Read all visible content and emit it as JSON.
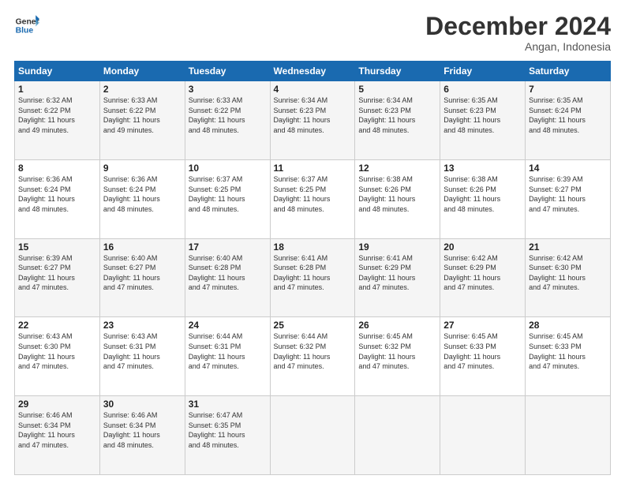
{
  "logo": {
    "line1": "General",
    "line2": "Blue"
  },
  "header": {
    "month": "December 2024",
    "location": "Angan, Indonesia"
  },
  "weekdays": [
    "Sunday",
    "Monday",
    "Tuesday",
    "Wednesday",
    "Thursday",
    "Friday",
    "Saturday"
  ],
  "weeks": [
    [
      {
        "day": "1",
        "info": "Sunrise: 6:32 AM\nSunset: 6:22 PM\nDaylight: 11 hours\nand 49 minutes."
      },
      {
        "day": "2",
        "info": "Sunrise: 6:33 AM\nSunset: 6:22 PM\nDaylight: 11 hours\nand 49 minutes."
      },
      {
        "day": "3",
        "info": "Sunrise: 6:33 AM\nSunset: 6:22 PM\nDaylight: 11 hours\nand 48 minutes."
      },
      {
        "day": "4",
        "info": "Sunrise: 6:34 AM\nSunset: 6:23 PM\nDaylight: 11 hours\nand 48 minutes."
      },
      {
        "day": "5",
        "info": "Sunrise: 6:34 AM\nSunset: 6:23 PM\nDaylight: 11 hours\nand 48 minutes."
      },
      {
        "day": "6",
        "info": "Sunrise: 6:35 AM\nSunset: 6:23 PM\nDaylight: 11 hours\nand 48 minutes."
      },
      {
        "day": "7",
        "info": "Sunrise: 6:35 AM\nSunset: 6:24 PM\nDaylight: 11 hours\nand 48 minutes."
      }
    ],
    [
      {
        "day": "8",
        "info": "Sunrise: 6:36 AM\nSunset: 6:24 PM\nDaylight: 11 hours\nand 48 minutes."
      },
      {
        "day": "9",
        "info": "Sunrise: 6:36 AM\nSunset: 6:24 PM\nDaylight: 11 hours\nand 48 minutes."
      },
      {
        "day": "10",
        "info": "Sunrise: 6:37 AM\nSunset: 6:25 PM\nDaylight: 11 hours\nand 48 minutes."
      },
      {
        "day": "11",
        "info": "Sunrise: 6:37 AM\nSunset: 6:25 PM\nDaylight: 11 hours\nand 48 minutes."
      },
      {
        "day": "12",
        "info": "Sunrise: 6:38 AM\nSunset: 6:26 PM\nDaylight: 11 hours\nand 48 minutes."
      },
      {
        "day": "13",
        "info": "Sunrise: 6:38 AM\nSunset: 6:26 PM\nDaylight: 11 hours\nand 48 minutes."
      },
      {
        "day": "14",
        "info": "Sunrise: 6:39 AM\nSunset: 6:27 PM\nDaylight: 11 hours\nand 47 minutes."
      }
    ],
    [
      {
        "day": "15",
        "info": "Sunrise: 6:39 AM\nSunset: 6:27 PM\nDaylight: 11 hours\nand 47 minutes."
      },
      {
        "day": "16",
        "info": "Sunrise: 6:40 AM\nSunset: 6:27 PM\nDaylight: 11 hours\nand 47 minutes."
      },
      {
        "day": "17",
        "info": "Sunrise: 6:40 AM\nSunset: 6:28 PM\nDaylight: 11 hours\nand 47 minutes."
      },
      {
        "day": "18",
        "info": "Sunrise: 6:41 AM\nSunset: 6:28 PM\nDaylight: 11 hours\nand 47 minutes."
      },
      {
        "day": "19",
        "info": "Sunrise: 6:41 AM\nSunset: 6:29 PM\nDaylight: 11 hours\nand 47 minutes."
      },
      {
        "day": "20",
        "info": "Sunrise: 6:42 AM\nSunset: 6:29 PM\nDaylight: 11 hours\nand 47 minutes."
      },
      {
        "day": "21",
        "info": "Sunrise: 6:42 AM\nSunset: 6:30 PM\nDaylight: 11 hours\nand 47 minutes."
      }
    ],
    [
      {
        "day": "22",
        "info": "Sunrise: 6:43 AM\nSunset: 6:30 PM\nDaylight: 11 hours\nand 47 minutes."
      },
      {
        "day": "23",
        "info": "Sunrise: 6:43 AM\nSunset: 6:31 PM\nDaylight: 11 hours\nand 47 minutes."
      },
      {
        "day": "24",
        "info": "Sunrise: 6:44 AM\nSunset: 6:31 PM\nDaylight: 11 hours\nand 47 minutes."
      },
      {
        "day": "25",
        "info": "Sunrise: 6:44 AM\nSunset: 6:32 PM\nDaylight: 11 hours\nand 47 minutes."
      },
      {
        "day": "26",
        "info": "Sunrise: 6:45 AM\nSunset: 6:32 PM\nDaylight: 11 hours\nand 47 minutes."
      },
      {
        "day": "27",
        "info": "Sunrise: 6:45 AM\nSunset: 6:33 PM\nDaylight: 11 hours\nand 47 minutes."
      },
      {
        "day": "28",
        "info": "Sunrise: 6:45 AM\nSunset: 6:33 PM\nDaylight: 11 hours\nand 47 minutes."
      }
    ],
    [
      {
        "day": "29",
        "info": "Sunrise: 6:46 AM\nSunset: 6:34 PM\nDaylight: 11 hours\nand 47 minutes."
      },
      {
        "day": "30",
        "info": "Sunrise: 6:46 AM\nSunset: 6:34 PM\nDaylight: 11 hours\nand 48 minutes."
      },
      {
        "day": "31",
        "info": "Sunrise: 6:47 AM\nSunset: 6:35 PM\nDaylight: 11 hours\nand 48 minutes."
      },
      {
        "day": "",
        "info": ""
      },
      {
        "day": "",
        "info": ""
      },
      {
        "day": "",
        "info": ""
      },
      {
        "day": "",
        "info": ""
      }
    ]
  ]
}
